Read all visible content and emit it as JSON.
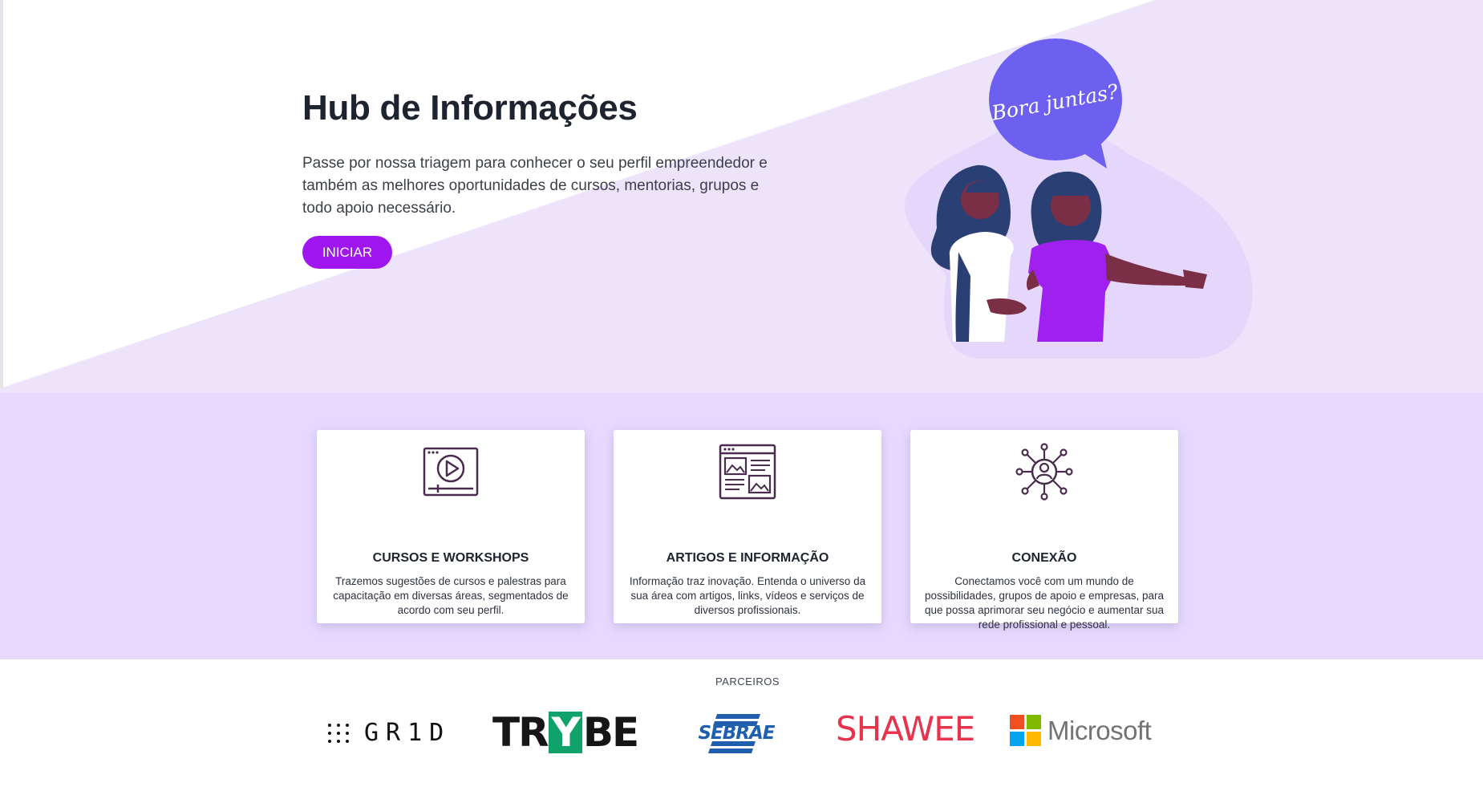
{
  "hero": {
    "title": "Hub de Informações",
    "description": "Passe por nossa triagem para conhecer o seu perfil empreendedor e também as melhores oportunidades de cursos, mentorias, grupos e todo apoio necessário.",
    "button_label": "INICIAR",
    "speech_bubble": "Bora juntas?"
  },
  "features": [
    {
      "icon": "video-player-icon",
      "title": "CURSOS E WORKSHOPS",
      "description": "Trazemos sugestões de cursos e palestras para capacitação em diversas áreas, segmentados de acordo com seu perfil."
    },
    {
      "icon": "article-layout-icon",
      "title": "ARTIGOS E INFORMAÇÃO",
      "description": "Informação traz inovação. Entenda o universo da sua área com artigos, links, vídeos e serviços de diversos profissionais."
    },
    {
      "icon": "network-connection-icon",
      "title": "CONEXÃO",
      "description": "Conectamos você com um mundo de possibilidades, grupos de apoio e empresas, para que possa aprimorar seu negócio e aumentar sua rede profissional e pessoal."
    }
  ],
  "partners": {
    "label": "PARCEIROS",
    "logos": [
      {
        "name": "GR1D",
        "text": "GR1D"
      },
      {
        "name": "Trybe",
        "text_before": "TR",
        "text_highlight": "Y",
        "text_after": "BE"
      },
      {
        "name": "Sebrae",
        "text": "SEBRAE"
      },
      {
        "name": "Shawee",
        "text": "SHAWEE"
      },
      {
        "name": "Microsoft",
        "text": "Microsoft"
      }
    ]
  },
  "colors": {
    "accent": "#a016f0",
    "hero_bg": "#ede4fc",
    "features_bg": "#e6d9fd",
    "bubble": "#6d5ff0",
    "trybe_green": "#0fa36b",
    "sebrae_blue": "#1f5fae",
    "shawee_red": "#e8334d"
  }
}
